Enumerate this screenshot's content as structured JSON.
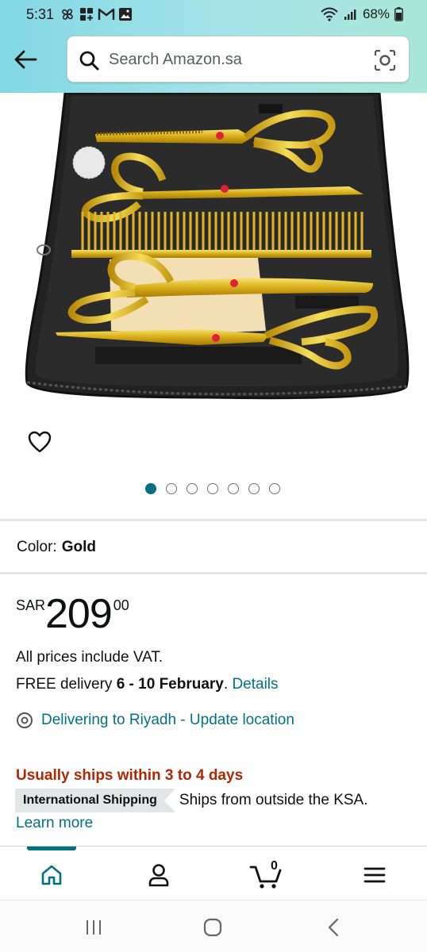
{
  "status_bar": {
    "time": "5:31",
    "battery": "68%"
  },
  "header": {
    "search_placeholder": "Search Amazon.sa"
  },
  "product_image": {
    "image_count": 7,
    "active_index": 0
  },
  "variant": {
    "color_label": "Color:",
    "color_value": "Gold"
  },
  "price": {
    "currency": "SAR",
    "whole": "209",
    "fraction": "00"
  },
  "info": {
    "vat_text": "All prices include VAT.",
    "delivery_prefix": "FREE delivery ",
    "delivery_dates": "6 - 10 February",
    "delivery_suffix": ". ",
    "details_link": "Details",
    "location_text": "Delivering to Riyadh - Update location",
    "ships_within": "Usually ships within 3 to 4 days",
    "intl_badge": "International Shipping",
    "intl_text": "Ships from outside the KSA.",
    "learn_more": "Learn more"
  },
  "bottom_nav": {
    "cart_count": "0",
    "active_tab": "home"
  },
  "colors": {
    "accent": "#007185",
    "price_alert": "#b12704",
    "header_gradient_start": "#82d8e3",
    "header_gradient_end": "#a9e7d8"
  }
}
